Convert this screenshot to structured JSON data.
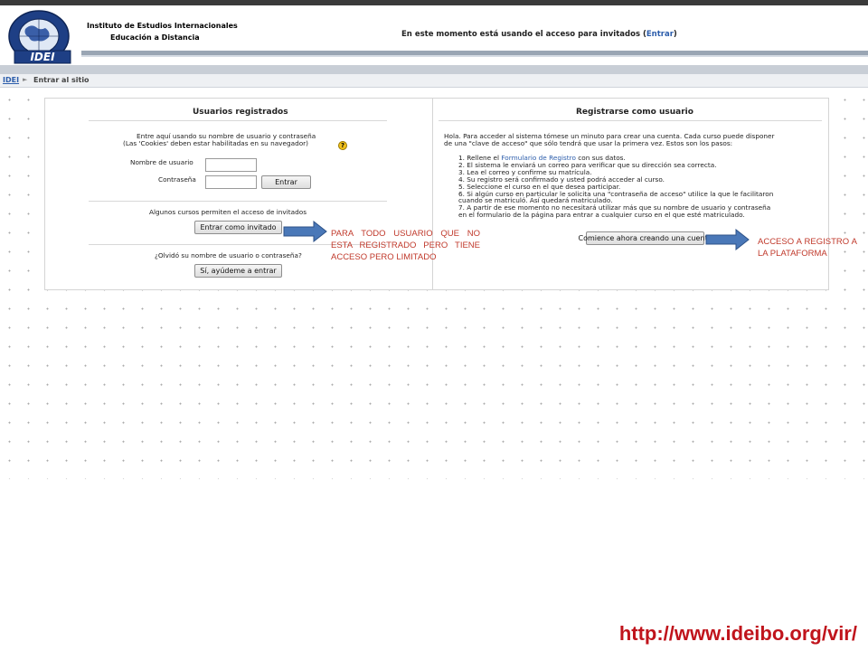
{
  "header": {
    "institute_line1": "Instituto de Estudios Internacionales",
    "institute_line2": "Educación a Distancia",
    "logo_text": "IDEI",
    "guest_message": "En este momento está usando el acceso para invitados (",
    "guest_link": "Entrar",
    "guest_message_end": ")"
  },
  "breadcrumb": {
    "home": "IDEI",
    "separator": "►",
    "current": "Entrar al sitio"
  },
  "login_panel": {
    "title": "Usuarios registrados",
    "intro_line1": "Entre aquí usando su nombre de usuario y contraseña",
    "intro_line2": "(Las 'Cookies' deben estar habilitadas en su navegador)",
    "username_label": "Nombre de usuario",
    "username_value": "",
    "password_label": "Contraseña",
    "password_value": "",
    "login_button": "Entrar",
    "guest_text": "Algunos cursos permiten el acceso de invitados",
    "guest_button": "Entrar como invitado",
    "forgot_text": "¿Olvidó su nombre de usuario o contraseña?",
    "forgot_button": "Sí, ayúdeme a entrar"
  },
  "signup_panel": {
    "title": "Registrarse como usuario",
    "intro_line1": "Hola. Para acceder al sistema tómese un minuto para crear una cuenta. Cada curso puede disponer",
    "intro_line2": "de una \"clave de acceso\" que sólo tendrá que usar la primera vez. Estos son los pasos:",
    "steps": [
      {
        "prefix": "1. Rellene el ",
        "link": "Formulario de Registro",
        "suffix": " con sus datos."
      },
      {
        "prefix": "2. El sistema le enviará un correo para verificar que su dirección sea correcta."
      },
      {
        "prefix": "3. Lea el correo y confirme su matrícula."
      },
      {
        "prefix": "4. Su registro será confirmado y usted podrá acceder al curso."
      },
      {
        "prefix": "5. Seleccione el curso en el que desea participar."
      },
      {
        "prefix": "6. Si algún curso en particular le solicita una \"contraseña de acceso\" utilice la que le facilitaron"
      },
      {
        "prefix": "    cuando se matriculó. Así quedará matriculado."
      },
      {
        "prefix": "7. A partir de ese momento no necesitará utilizar más que su nombre de usuario y contraseña"
      },
      {
        "prefix": "    en el formulario de la página para entrar a cualquier curso en el que esté matriculado."
      }
    ],
    "signup_button": "Comience ahora creando una cuenta"
  },
  "annotations": {
    "guest_note": "PARA TODO USUARIO QUE NO ESTA REGISTRADO PERO TIENE ACCESO PERO LIMITADO",
    "signup_note": "ACCESO A REGISTRO A LA PLATAFORMA",
    "arrow_color": "#4a78b8"
  },
  "footer_url": "http://www.ideibo.org/vir/",
  "colors": {
    "link": "#2c5dab",
    "annotation": "#c0392b",
    "url": "#c0141c"
  }
}
